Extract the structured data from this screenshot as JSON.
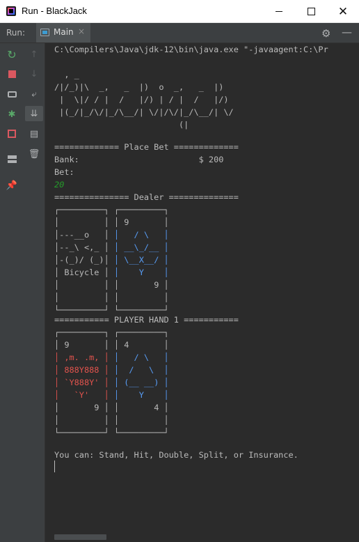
{
  "window": {
    "title": "Run - BlackJack",
    "minimize_icon": "minimize-icon",
    "maximize_icon": "maximize-icon",
    "close_icon": "close-icon"
  },
  "toolwindow": {
    "run_label": "Run:",
    "tab_label": "Main",
    "tab_close": "×",
    "tab_icon": "console-app-icon",
    "settings_icon": "gear-icon",
    "hide_icon": "minimize-panel-icon"
  },
  "left_toolbar": [
    {
      "name": "rerun-icon",
      "color": "#59a869"
    },
    {
      "name": "stop-icon",
      "color": "#db5860"
    },
    {
      "name": "camera-icon",
      "color": "#afb1b3"
    },
    {
      "name": "debug-icon",
      "color": "#59a869"
    },
    {
      "name": "exit-icon",
      "color": "#db5860"
    },
    {
      "name": "layout-icon",
      "color": "#afb1b3"
    },
    {
      "name": "pin-icon",
      "color": "#afb1b3"
    }
  ],
  "second_toolbar": [
    {
      "name": "up-arrow-icon"
    },
    {
      "name": "down-arrow-icon"
    },
    {
      "name": "soft-wrap-icon"
    },
    {
      "name": "scroll-to-end-icon"
    },
    {
      "name": "print-icon"
    },
    {
      "name": "trash-icon"
    }
  ],
  "console": {
    "command": "C:\\Compilers\\Java\\jdk-12\\bin\\java.exe \"-javaagent:C:\\Pr",
    "banner": [
      "  , _",
      "/|/_)|\\  _,   _  |)  o  _,   _  |)",
      " |  \\|/ / |  /   |/) | / |  /   |/)",
      " |(_/|_/\\/|_/\\__/| \\/|/\\/|_/\\__/| \\/",
      "                         (|"
    ],
    "place_bet_header": "============= Place Bet =============",
    "bank_label": "Bank:",
    "bank_value": "$ 200",
    "bet_label": "Bet:",
    "bet_input": "20",
    "dealer_header": "=============== Dealer ==============",
    "dealer_cards": [
      [
        "┌─────────┐",
        "│         │",
        "│---__o   │",
        "│--_\\ <,_ │",
        "│-(_)/ (_)│",
        "│ Bicycle │",
        "│         │",
        "│         │",
        "└─────────┘"
      ],
      [
        "┌─────────┐",
        "│ 9       │",
        "│   / \\   │",
        "│ __\\_/__ │",
        "│ \\__X__/ │",
        "│    Y    │",
        "│       9 │",
        "│         │",
        "└─────────┘"
      ]
    ],
    "player_header": "=========== PLAYER HAND 1 ===========",
    "player_cards": [
      [
        "┌─────────┐",
        "│ 9       │",
        "│ ,m. .m, │",
        "│ 888Y888 │",
        "│ `Y888Y' │",
        "│   `Y'   │",
        "│       9 │",
        "│         │",
        "└─────────┘"
      ],
      [
        "┌─────────┐",
        "│ 4       │",
        "│   / \\   │",
        "│  /   \\  │",
        "│ (__ __) │",
        "│    Y    │",
        "│       4 │",
        "│         │",
        "└─────────┘"
      ]
    ],
    "prompt": "You can: Stand, Hit, Double, Split, or Insurance."
  }
}
